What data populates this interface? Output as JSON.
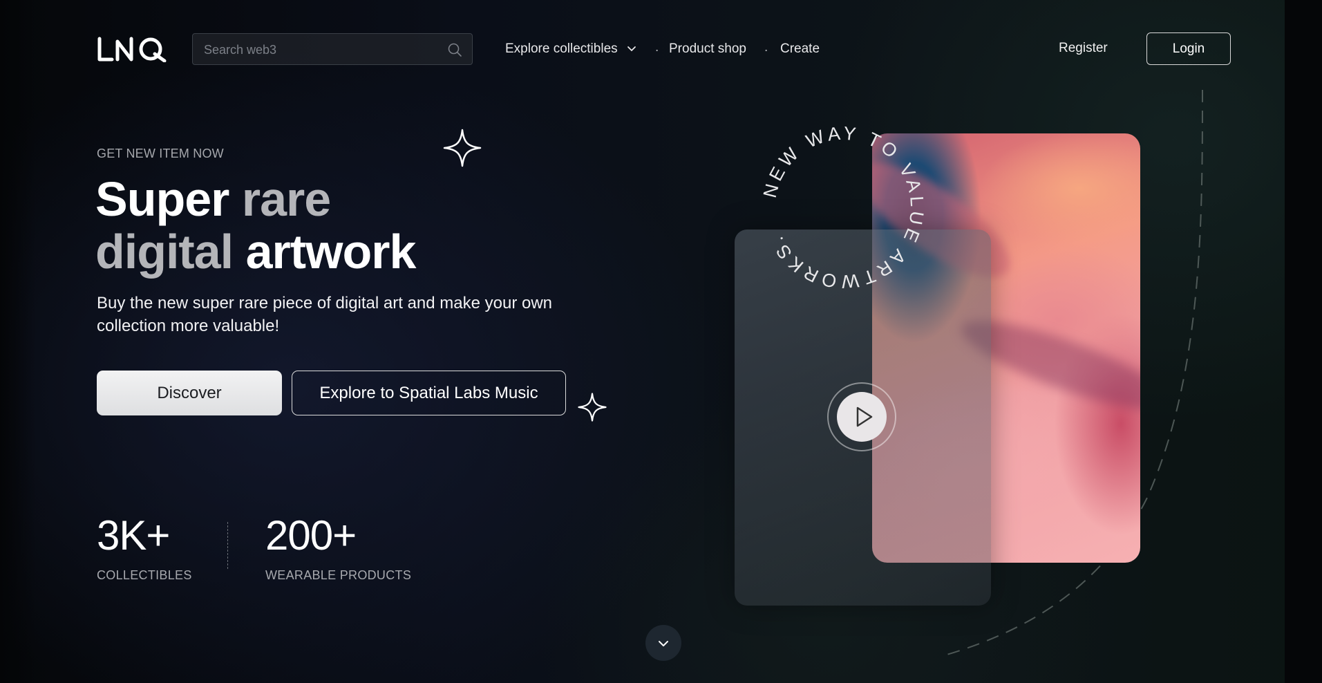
{
  "header": {
    "logo": "LNQ",
    "search_placeholder": "Search web3",
    "nav": {
      "explore": "Explore collectibles",
      "product_shop": "Product shop",
      "create": "Create",
      "separator": "."
    },
    "register": "Register",
    "login": "Login"
  },
  "hero": {
    "eyebrow": "GET NEW ITEM NOW",
    "headline": {
      "w1": "Super",
      "g1": "rare",
      "g2": "digital",
      "w2": "artwork"
    },
    "subtitle": "Buy the new super rare piece of digital art and make your own collection more valuable!",
    "discover_label": "Discover",
    "explore_label": "Explore to Spatial Labs Music"
  },
  "stats": [
    {
      "value": "3K+",
      "label": "COLLECTIBLES"
    },
    {
      "value": "200+",
      "label": "WEARABLE PRODUCTS"
    }
  ],
  "artwork": {
    "circle_text": "NEW WAY TO VALUE ARTWORKS."
  },
  "icons": {
    "search": "search-icon",
    "chevron": "chevron-down-icon",
    "play": "play-icon",
    "sparkle": "sparkle-icon",
    "scroll": "chevron-down-icon"
  },
  "colors": {
    "background": "#06090d",
    "primary_button": "#e6e7e9",
    "muted_text": "#a6a8ad"
  }
}
